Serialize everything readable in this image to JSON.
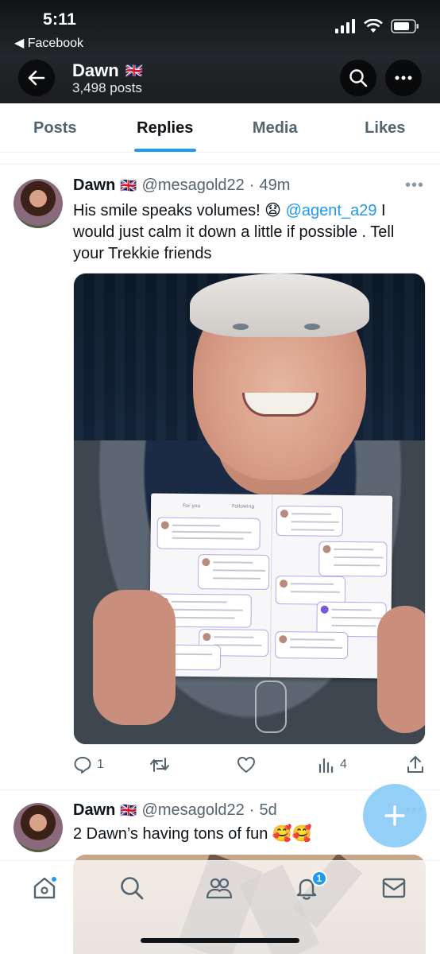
{
  "status_bar": {
    "time": "5:11",
    "back_app": "◀ Facebook"
  },
  "profile_header": {
    "name": "Dawn",
    "flag": "🇬🇧",
    "post_count": "3,498 posts"
  },
  "tabs": [
    {
      "label": "Posts",
      "active": false
    },
    {
      "label": "Replies",
      "active": true
    },
    {
      "label": "Media",
      "active": false
    },
    {
      "label": "Likes",
      "active": false
    }
  ],
  "tweets": [
    {
      "name": "Dawn",
      "flag": "🇬🇧",
      "handle": "@mesagold22",
      "separator": "·",
      "time": "49m",
      "menu": "•••",
      "text_before": "His smile speaks volumes! 😧 ",
      "mention": "@agent_a29",
      "text_after": " I would just calm it down a little if possible . Tell your Trekkie friends",
      "media": {
        "booklet_tab_left": "For you",
        "booklet_tab_right": "Following"
      },
      "actions": {
        "replies": "1",
        "reposts": "",
        "likes": "",
        "views": "4"
      }
    },
    {
      "name": "Dawn",
      "flag": "🇬🇧",
      "handle": "@mesagold22",
      "separator": "·",
      "time": "5d",
      "menu": "•••",
      "text": "2 Dawn’s having tons of fun 🥰🥰"
    }
  ],
  "bottom_nav": {
    "items": [
      "home-icon",
      "search-icon",
      "communities-icon",
      "notifications-icon",
      "messages-icon"
    ],
    "notification_count": "1"
  },
  "colors": {
    "accent": "#1d9bf0",
    "text": "#0f1419",
    "muted": "#536471"
  }
}
